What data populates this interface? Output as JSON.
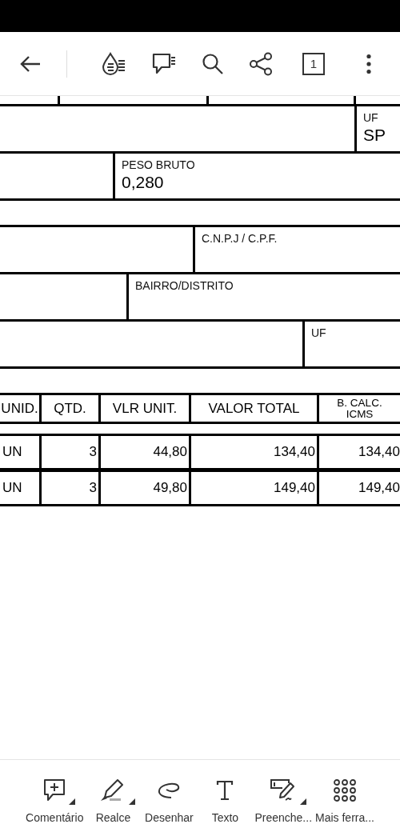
{
  "toolbar": {
    "page_number": "1"
  },
  "form_fields": [
    {
      "label": "UF",
      "value": "SP"
    },
    {
      "label": "PESO BRUTO",
      "value": "0,280"
    },
    {
      "label": "C.N.P.J / C.P.F."
    },
    {
      "label": "BAIRRO/DISTRITO"
    },
    {
      "label": "UF"
    }
  ],
  "table": {
    "columns": [
      "UNID.",
      "QTD.",
      "VLR UNIT.",
      "VALOR TOTAL",
      "B. CALC. ICMS"
    ],
    "rows": [
      [
        "UN",
        "3",
        "44,80",
        "134,40",
        "134,40"
      ],
      [
        "UN",
        "3",
        "49,80",
        "149,40",
        "149,40"
      ]
    ]
  },
  "tools": [
    {
      "label": "Comentário",
      "has_menu": true
    },
    {
      "label": "Realce",
      "has_menu": true
    },
    {
      "label": "Desenhar",
      "has_menu": false
    },
    {
      "label": "Texto",
      "has_menu": false
    },
    {
      "label": "Preenche...",
      "has_menu": true
    },
    {
      "label": "Mais ferra...",
      "has_menu": false
    }
  ]
}
